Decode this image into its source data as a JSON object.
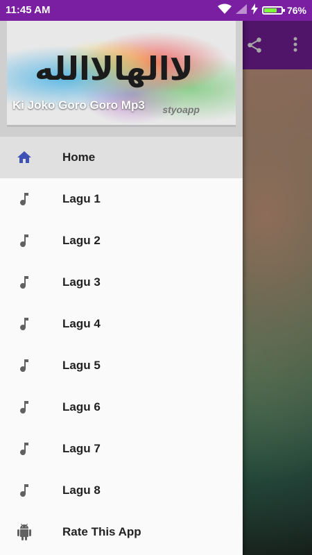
{
  "status_bar": {
    "time": "11:45 AM",
    "battery_percent": "76%",
    "battery_level": 0.76,
    "battery_color": "#7cff3b"
  },
  "app_bar": {
    "color": "#7b1fa2",
    "actions": [
      {
        "icon": "share-icon"
      },
      {
        "icon": "more-vert-icon"
      }
    ]
  },
  "drawer": {
    "header": {
      "title": "Ki Joko Goro Goro Mp3",
      "calligraphy": "لاالهالاالله",
      "watermark": "styoapp"
    },
    "items": [
      {
        "label": "Home",
        "icon": "home-icon",
        "active": true
      },
      {
        "label": "Lagu 1",
        "icon": "music-note-icon"
      },
      {
        "label": "Lagu 2",
        "icon": "music-note-icon"
      },
      {
        "label": "Lagu 3",
        "icon": "music-note-icon"
      },
      {
        "label": "Lagu 4",
        "icon": "music-note-icon"
      },
      {
        "label": "Lagu 5",
        "icon": "music-note-icon"
      },
      {
        "label": "Lagu 6",
        "icon": "music-note-icon"
      },
      {
        "label": "Lagu 7",
        "icon": "music-note-icon"
      },
      {
        "label": "Lagu 8",
        "icon": "music-note-icon"
      },
      {
        "label": "Rate This App",
        "icon": "android-icon"
      }
    ]
  },
  "colors": {
    "accent_home": "#3f51b5",
    "icon_gray": "#616161"
  }
}
